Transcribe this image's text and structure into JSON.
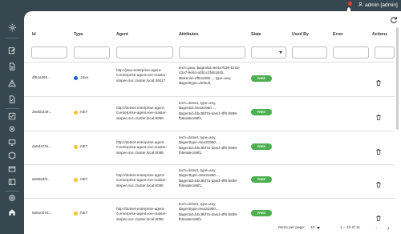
{
  "header": {
    "user_label": "admin [admin]",
    "notification_count": 1,
    "bell_icon": "bell-icon",
    "user_icon": "person-icon"
  },
  "sidebar": {
    "icons": [
      "gear-icon",
      "edit-icon",
      "document-icon",
      "warning-icon",
      "document-check-icon",
      "approve-icon",
      "settings-cog-icon",
      "hexagon-icon",
      "card-icon",
      "ring-icon",
      "home-icon"
    ]
  },
  "toolbar": {
    "refresh_icon": "refresh-icon"
  },
  "table": {
    "columns": [
      "Id",
      "Type",
      "Agent",
      "Attributes",
      "State",
      "Used By",
      "Error",
      "Actions"
    ],
    "rows": [
      {
        "id": "df54a360...",
        "type": ".Java",
        "type_color": "#1565c0",
        "agent": "http://java-enterprise-agent-0.enterprise-agent.exe-master-stepee.svc.cluster.local:46017",
        "attributes": "tech=java, $agentid=9e4e7b39-b102-43a7-9eb4-a3b1c2fd6184b, $tokenid=df54a360..., type=any, $agenttype=default,",
        "state": "FREE"
      },
      {
        "id": "26ebb349...",
        "type": ".NET",
        "type_color": "#fbc02d",
        "agent": "http://dotnet-enterprise-agent-0.enterprise-agent.exe-master-stepee.svc.cluster.local:8098",
        "attributes": "tech=dotnet, type=any, $agentid=6ea31950..., $agentid=bbc9bf7a-da4d-4ff6-b889-fb6ea8e166f1,",
        "state": "FREE"
      },
      {
        "id": "da9d477e...",
        "type": ".NET",
        "type_color": "#fbc02d",
        "agent": "http://dotnet-enterprise-agent-0.enterprise-agent.exe-master-stepee.svc.cluster.local:8098",
        "attributes": "tech=dotnet, type=any, $agenttype=6ea31950..., $agentid=bbc9bf7a-da4d-4ff6-b889-fb6ea8e166f1,",
        "state": "FREE"
      },
      {
        "id": "a5866df3...",
        "type": ".NET",
        "type_color": "#fbc02d",
        "agent": "http://dotnet-enterprise-agent-0.enterprise-agent.exe-master-stepee.svc.cluster.local:8098",
        "attributes": "tech=dotnet, type=any, $agenttype=6ea31950..., $agentid=bbc9bf7a-da4d-4ff6-b889-fb6ea8e166f1,",
        "state": "FREE"
      },
      {
        "id": "9a51007d...",
        "type": ".NET",
        "type_color": "#fbc02d",
        "agent": "http://dotnet-enterprise-agent-0.enterprise-agent.exe-master-stepee.svc.cluster.local:8098",
        "attributes": "tech=dotnet, type=any, $agenttype=6ea31950..., $agentid=bbc9bf7a-da4d-4ff6-b889-fb6ea8e166f1,",
        "state": "FREE"
      }
    ]
  },
  "pagination": {
    "items_per_page_label": "Items per page:",
    "items_per_page_value": "10",
    "range_label": "1 – 10 of 11",
    "prev_icon": "chevron-left-icon",
    "next_icon": "chevron-right-icon"
  },
  "colors": {
    "sidebar_bg": "#37474f",
    "badge_green": "#4caf50",
    "java_blue": "#1565c0",
    "dotnet_yellow": "#fbc02d"
  }
}
